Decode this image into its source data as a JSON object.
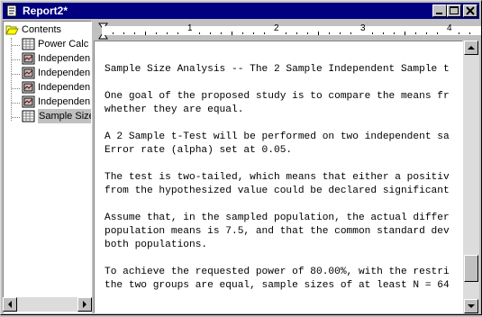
{
  "window": {
    "title": "Report2*"
  },
  "tree": {
    "root": "Contents",
    "items": [
      {
        "label": "Power Calc"
      },
      {
        "label": "Independen"
      },
      {
        "label": "Independen"
      },
      {
        "label": "Independen"
      },
      {
        "label": "Independen"
      },
      {
        "label": "Sample Size"
      }
    ]
  },
  "ruler": {
    "marks": [
      "1",
      "2",
      "3",
      "4"
    ]
  },
  "document": {
    "lines": [
      "Sample Size Analysis -- The 2 Sample Independent Sample t",
      "",
      "One goal of the proposed study is to compare the means fr",
      "whether they are equal.",
      "",
      "A 2 Sample t-Test will be performed on two independent sa",
      "Error rate (alpha) set at 0.05.",
      "",
      "The test is two-tailed, which means that either a positiv",
      "from the hypothesized value could be declared significant",
      "",
      "Assume that, in the sampled population, the actual differ",
      "population means is 7.5, and that the common standard dev",
      "both populations.",
      "",
      "To achieve the requested power of 80.00%, with the restri",
      "the two groups are equal, sample sizes of at least N = 64"
    ]
  }
}
